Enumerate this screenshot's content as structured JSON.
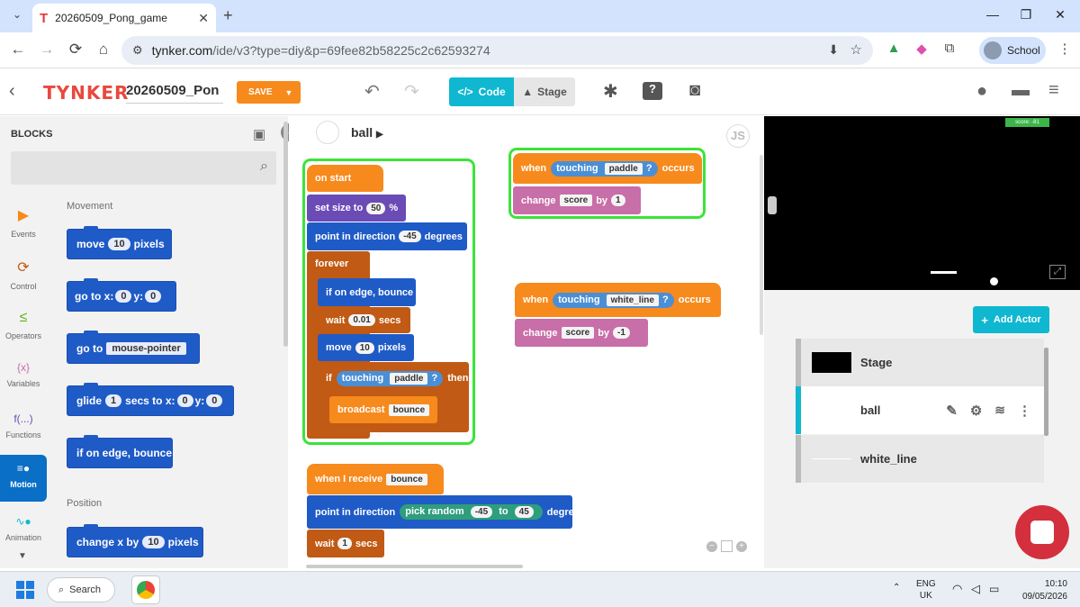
{
  "browser": {
    "tab_title": "20260509_Pong_game",
    "url_domain": "tynker.com",
    "url_path": "/ide/v3?type=diy&p=69fee82b58225c2c62593274",
    "profile_label": "School"
  },
  "header": {
    "logo": "TYNKER",
    "project_name": "20260509_Pon",
    "save_label": "SAVE",
    "code_label": "Code",
    "stage_label": "Stage"
  },
  "blocks_panel": {
    "title": "BLOCKS",
    "categories": [
      {
        "label": "Events",
        "icon": "flag-icon",
        "glyph": "▶",
        "color": "#f78a1d"
      },
      {
        "label": "Control",
        "icon": "loop-icon",
        "glyph": "⟳",
        "color": "#c15a14"
      },
      {
        "label": "Operators",
        "icon": "operators-icon",
        "glyph": "≤",
        "color": "#5bb517"
      },
      {
        "label": "Variables",
        "icon": "variables-icon",
        "glyph": "{x}",
        "color": "#c86ea8"
      },
      {
        "label": "Functions",
        "icon": "functions-icon",
        "glyph": "f(...)",
        "color": "#6b4bb5"
      },
      {
        "label": "Motion",
        "icon": "motion-icon",
        "glyph": "≡●",
        "color": "#ffffff"
      },
      {
        "label": "Animation",
        "icon": "animation-icon",
        "glyph": "∿●",
        "color": "#0fb8d0"
      }
    ],
    "sections": {
      "movement": "Movement",
      "position": "Position"
    },
    "palette": {
      "move": {
        "pre": "move",
        "v": "10",
        "post": "pixels"
      },
      "goto_xy": {
        "pre": "go to x:",
        "x": "0",
        "ylab": "y:",
        "y": "0"
      },
      "goto_mouse": {
        "pre": "go to",
        "v": "mouse-pointer"
      },
      "glide": {
        "pre": "glide",
        "s": "1",
        "mid": "secs to x:",
        "x": "0",
        "ylab": "y:",
        "y": "0"
      },
      "edge": {
        "label": "if on edge, bounce"
      },
      "changex": {
        "pre": "change x by",
        "v": "10",
        "post": "pixels"
      }
    }
  },
  "canvas": {
    "actor": "ball",
    "js_label": "JS",
    "script1": {
      "on_start": "on start",
      "set_size": {
        "pre": "set size to",
        "v": "50",
        "post": "%"
      },
      "point_dir": {
        "pre": "point in direction",
        "v": "-45",
        "post": "degrees"
      },
      "forever": "forever",
      "edge": "if on edge, bounce",
      "wait": {
        "pre": "wait",
        "v": "0.01",
        "post": "secs"
      },
      "move": {
        "pre": "move",
        "v": "10",
        "post": "pixels"
      },
      "if": {
        "pre": "if",
        "sense": "touching",
        "target": "paddle",
        "q": "?",
        "post": "then"
      },
      "broadcast": {
        "pre": "broadcast",
        "v": "bounce"
      }
    },
    "script2": {
      "when": "when",
      "sense": "touching",
      "target": "paddle",
      "q": "?",
      "occurs": "occurs",
      "change": {
        "pre": "change",
        "var": "score",
        "by": "by",
        "v": "1"
      }
    },
    "script3": {
      "when": "when",
      "sense": "touching",
      "target": "white_line",
      "q": "?",
      "occurs": "occurs",
      "change": {
        "pre": "change",
        "var": "score",
        "by": "by",
        "v": "-1"
      }
    },
    "script4": {
      "receive": {
        "pre": "when I receive",
        "v": "bounce"
      },
      "point_dir": {
        "pre": "point in direction",
        "op": "pick random",
        "a": "-45",
        "to": "to",
        "b": "45",
        "post": "degrees"
      },
      "wait": {
        "pre": "wait",
        "v": "1",
        "post": "secs"
      }
    }
  },
  "stage": {
    "score_text": "score: -81",
    "add_actor_label": "Add Actor",
    "actors": [
      "Stage",
      "ball",
      "white_line"
    ]
  },
  "taskbar": {
    "search_label": "Search",
    "lang": "ENG",
    "region": "UK",
    "time": "10:10",
    "date": "09/05/2026"
  }
}
